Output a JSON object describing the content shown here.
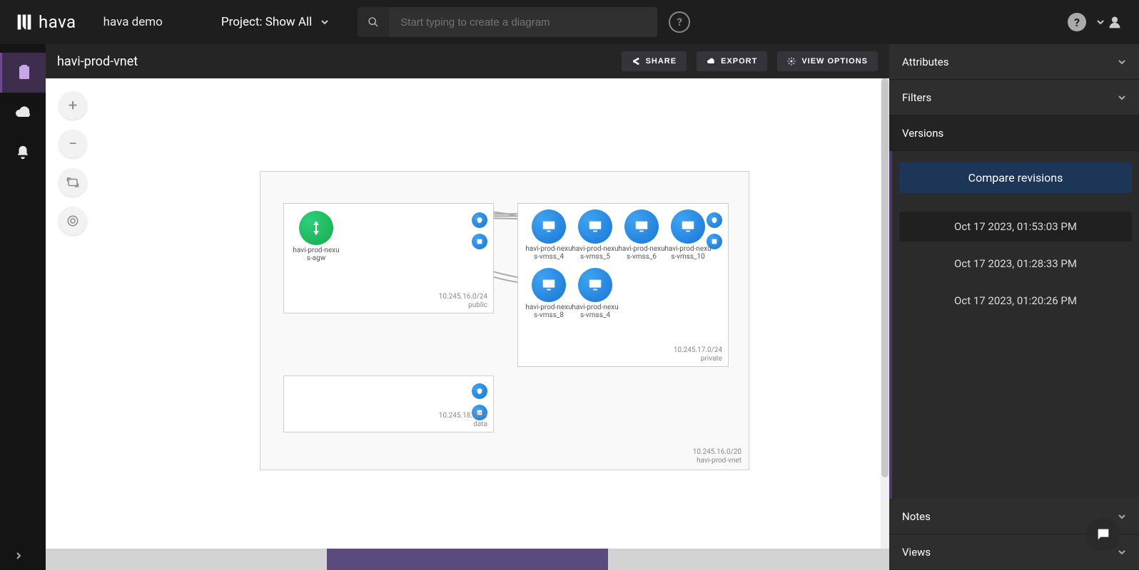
{
  "topbar": {
    "brand": "hava",
    "org": "hava demo",
    "project_label": "Project: Show All"
  },
  "search": {
    "placeholder": "Start typing to create a diagram"
  },
  "subheader": {
    "title": "havi-prod-vnet",
    "share": "Share",
    "export": "Export",
    "view_options": "View Options"
  },
  "rightpane": {
    "attributes": "Attributes",
    "filters": "Filters",
    "versions": "Versions",
    "compare": "Compare revisions",
    "ver": [
      "Oct 17 2023, 01:53:03 PM",
      "Oct 17 2023, 01:28:33 PM",
      "Oct 17 2023, 01:20:26 PM"
    ],
    "notes": "Notes",
    "views": "Views"
  },
  "diagram": {
    "vnet_name": "havi-prod-vnet",
    "vnet_cidr": "10.245.16.0/20",
    "subnets": {
      "public": {
        "name": "public",
        "cidr": "10.245.16.0/24"
      },
      "private": {
        "name": "private",
        "cidr": "10.245.17.0/24"
      },
      "data": {
        "name": "data",
        "cidr": "10.245.18.0/24"
      }
    },
    "agw": "havi-prod-nexus-agw",
    "vmss": [
      "havi-prod-nexus-vmss_4",
      "havi-prod-nexus-vmss_5",
      "havi-prod-nexus-vmss_6",
      "havi-prod-nexus-vmss_10",
      "havi-prod-nexus-vmss_8",
      "havi-prod-nexus-vmss_4"
    ]
  },
  "chart_data": {
    "type": "network-diagram",
    "vnet": {
      "name": "havi-prod-vnet",
      "cidr": "10.245.16.0/20"
    },
    "subnets": [
      {
        "name": "public",
        "cidr": "10.245.16.0/24",
        "nodes": [
          "havi-prod-nexus-agw"
        ]
      },
      {
        "name": "private",
        "cidr": "10.245.17.0/24",
        "nodes": [
          "havi-prod-nexus-vmss_4",
          "havi-prod-nexus-vmss_5",
          "havi-prod-nexus-vmss_6",
          "havi-prod-nexus-vmss_10",
          "havi-prod-nexus-vmss_8",
          "havi-prod-nexus-vmss_4"
        ]
      },
      {
        "name": "data",
        "cidr": "10.245.18.0/24",
        "nodes": []
      }
    ],
    "edges": [
      [
        "havi-prod-nexus-agw",
        "havi-prod-nexus-vmss_4"
      ],
      [
        "havi-prod-nexus-agw",
        "havi-prod-nexus-vmss_5"
      ],
      [
        "havi-prod-nexus-agw",
        "havi-prod-nexus-vmss_6"
      ],
      [
        "havi-prod-nexus-agw",
        "havi-prod-nexus-vmss_10"
      ],
      [
        "havi-prod-nexus-agw",
        "havi-prod-nexus-vmss_8"
      ],
      [
        "havi-prod-nexus-agw",
        "havi-prod-nexus-vmss_4 (2)"
      ]
    ]
  }
}
